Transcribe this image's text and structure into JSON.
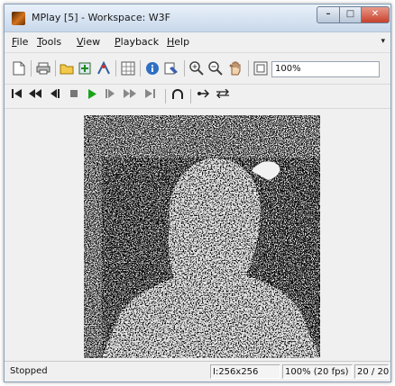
{
  "window": {
    "title": "MPlay [5] - Workspace: W3F",
    "buttons": {
      "minimize": "–",
      "maximize": "□",
      "close": "✕"
    }
  },
  "menubar": {
    "items": [
      "File",
      "Tools",
      "View",
      "Playback",
      "Help"
    ],
    "overflow_arrow": "▾"
  },
  "toolbar": {
    "icons": [
      "new-file-icon",
      "print-icon",
      "open-folder-icon",
      "export-icon",
      "data-cursor-icon",
      "pixel-region-icon",
      "info-icon",
      "colormap-icon",
      "zoom-in-icon",
      "zoom-out-icon",
      "pan-hand-icon",
      "fit-to-window-icon"
    ],
    "zoom_value": "100%"
  },
  "playback_toolbar": {
    "buttons": [
      "go-to-first-icon",
      "rewind-icon",
      "step-back-icon",
      "stop-icon",
      "play-icon",
      "step-forward-icon",
      "fast-forward-icon",
      "go-to-last-icon",
      "loop-icon",
      "jump-to-icon",
      "playback-mode-icon"
    ],
    "colors": {
      "play": "#19a319",
      "default": "#222222"
    }
  },
  "status": {
    "state": "Stopped",
    "dimensions": "I:256x256",
    "rate": "100% (20 fps)",
    "frame": "20 / 20"
  }
}
